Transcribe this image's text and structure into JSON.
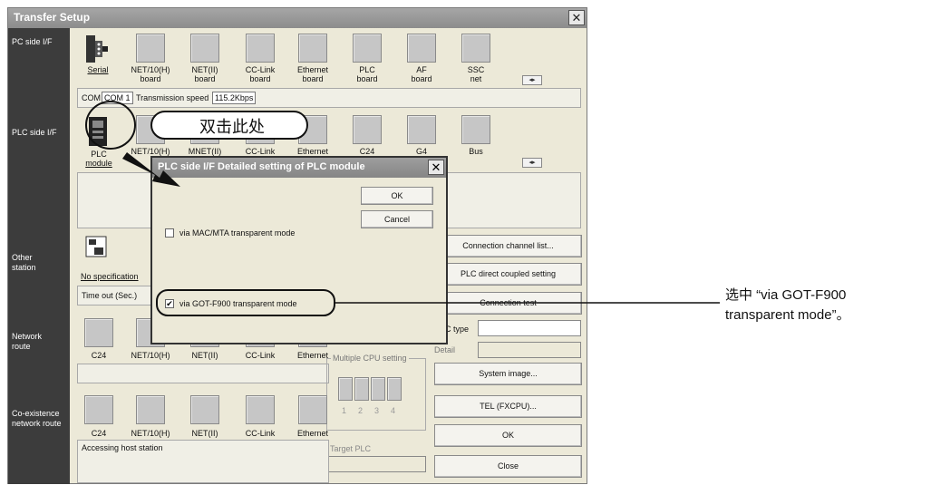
{
  "window": {
    "title": "Transfer Setup",
    "close": "✕"
  },
  "sidebar": {
    "pc_side": "PC side I/F",
    "plc_side": "PLC side I/F",
    "other_station": [
      "Other",
      "station"
    ],
    "network_route": [
      "Network",
      "route"
    ],
    "coexistence": [
      "Co-existence",
      "network route"
    ]
  },
  "pc_side": {
    "tiles": [
      {
        "label": [
          "Serial",
          ""
        ]
      },
      {
        "label": [
          "NET/10(H)",
          "board"
        ]
      },
      {
        "label": [
          "NET(II)",
          "board"
        ]
      },
      {
        "label": [
          "CC-Link",
          "board"
        ]
      },
      {
        "label": [
          "Ethernet",
          "board"
        ]
      },
      {
        "label": [
          "PLC",
          "board"
        ]
      },
      {
        "label": [
          "AF",
          "board"
        ]
      },
      {
        "label": [
          "SSC",
          "net"
        ]
      }
    ],
    "com_label": "COM",
    "com_value": "COM 1",
    "speed_label": "Transmission speed",
    "speed_value": "115.2Kbps"
  },
  "plc_side": {
    "tiles": [
      {
        "label": [
          "PLC",
          "module"
        ]
      },
      {
        "label": [
          "NET/10(H)",
          ""
        ]
      },
      {
        "label": [
          "MNET(II)",
          ""
        ]
      },
      {
        "label": [
          "CC-Link",
          ""
        ]
      },
      {
        "label": [
          "Ethernet",
          ""
        ]
      },
      {
        "label": [
          "C24",
          ""
        ]
      },
      {
        "label": [
          "G4",
          ""
        ]
      },
      {
        "label": [
          "Bus",
          ""
        ]
      }
    ]
  },
  "other_station": {
    "no_spec": "No specification",
    "timeout": "Time out (Sec.)"
  },
  "buttons": {
    "connection_channel": "Connection channel list...",
    "plc_direct": "PLC direct coupled setting",
    "connection_test": "Connection test",
    "system_image": "System image...",
    "tel": "TEL (FXCPU)...",
    "ok": "OK",
    "close": "Close"
  },
  "plc_type": {
    "label": "C type",
    "detail": "Detail"
  },
  "network_route": {
    "tiles": [
      "C24",
      "NET/10(H)",
      "NET(II)",
      "CC-Link",
      "Ethernet"
    ]
  },
  "multiple_cpu": {
    "label": "Multiple CPU setting",
    "nums": [
      "1",
      "2",
      "3",
      "4"
    ],
    "target": "Target PLC"
  },
  "coexistence": {
    "tiles": [
      "C24",
      "NET/10(H)",
      "NET(II)",
      "CC-Link",
      "Ethernet"
    ],
    "status": "Accessing host station"
  },
  "dialog": {
    "title": "PLC side I/F   Detailed setting of PLC module",
    "ok": "OK",
    "cancel": "Cancel",
    "mac_mta": "via MAC/MTA transparent mode",
    "got_f900": "via GOT-F900 transparent mode",
    "got_f900_checked": "✔",
    "close": "✕"
  },
  "annotations": {
    "double_click": "双击此处",
    "select_line1": "选中 “via GOT-F900",
    "select_line2": "transparent mode”。"
  }
}
